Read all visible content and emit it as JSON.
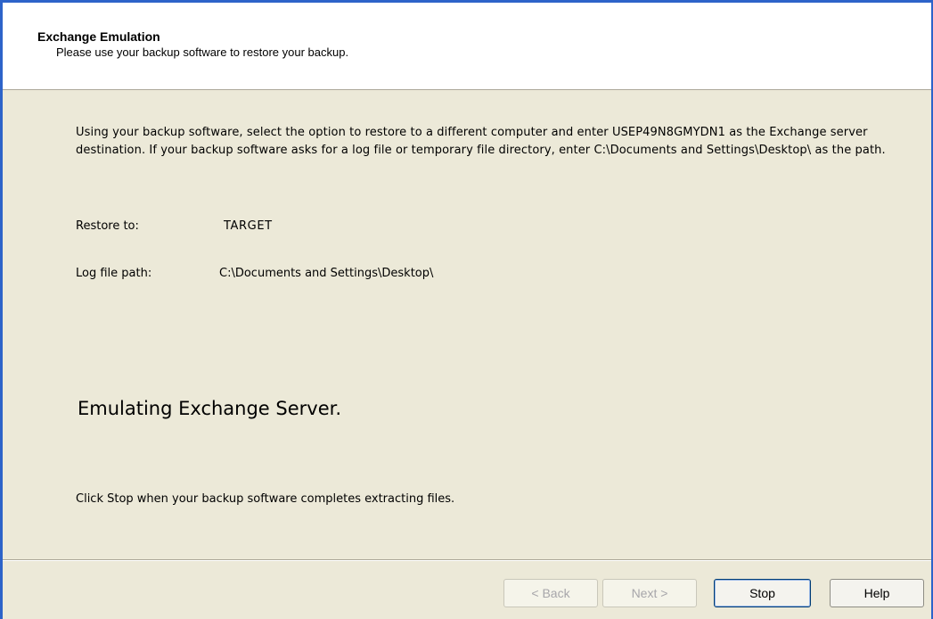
{
  "header": {
    "title": "Exchange Emulation",
    "subtitle": "Please use your backup software to restore your backup."
  },
  "instructions": "Using your backup software, select the option to restore to a different computer and enter USEP49N8GMYDN1 as the Exchange server destination.  If your backup software asks for a log file or temporary file directory, enter C:\\Documents and Settings\\Desktop\\ as the path.",
  "fields": {
    "restore_to": {
      "label": "Restore to:",
      "value": "TARGET"
    },
    "log_file_path": {
      "label": "Log file path:",
      "value": "C:\\Documents and Settings\\Desktop\\"
    }
  },
  "status": "Emulating Exchange Server.",
  "stop_hint": "Click Stop when your backup software completes extracting files.",
  "buttons": {
    "back": "< Back",
    "next": "Next >",
    "stop": "Stop",
    "help": "Help"
  },
  "colors": {
    "window_border": "#2d63c9",
    "panel_background": "#ece9d8",
    "header_background": "#ffffff",
    "disabled_text": "#a7a6aa"
  }
}
